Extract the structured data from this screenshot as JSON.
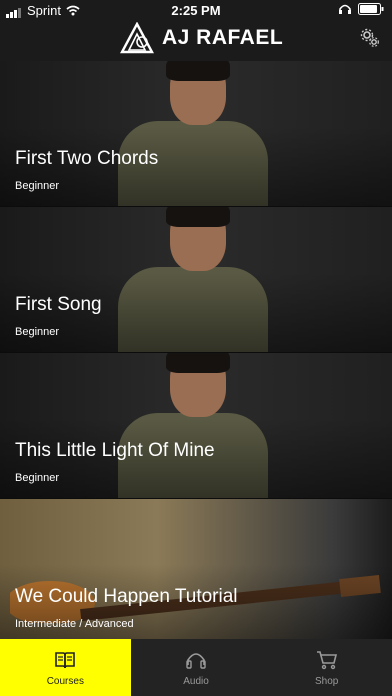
{
  "status": {
    "carrier": "Sprint",
    "time": "2:25 PM"
  },
  "header": {
    "logo_text": "AJ RAFAEL",
    "icons": [
      "logo-triangle-icon",
      "gear-icon"
    ]
  },
  "courses": [
    {
      "title": "First Two Chords",
      "level": "Beginner"
    },
    {
      "title": "First Song",
      "level": "Beginner"
    },
    {
      "title": "This Little Light Of Mine",
      "level": "Beginner"
    },
    {
      "title": "We Could Happen Tutorial",
      "level": "Intermediate / Advanced"
    }
  ],
  "tabs": [
    {
      "label": "Courses",
      "icon": "book-icon",
      "active": true
    },
    {
      "label": "Audio",
      "icon": "headphones-icon",
      "active": false
    },
    {
      "label": "Shop",
      "icon": "cart-icon",
      "active": false
    }
  ],
  "colors": {
    "active_tab": "#ffff00",
    "background": "#1b1b1b"
  }
}
